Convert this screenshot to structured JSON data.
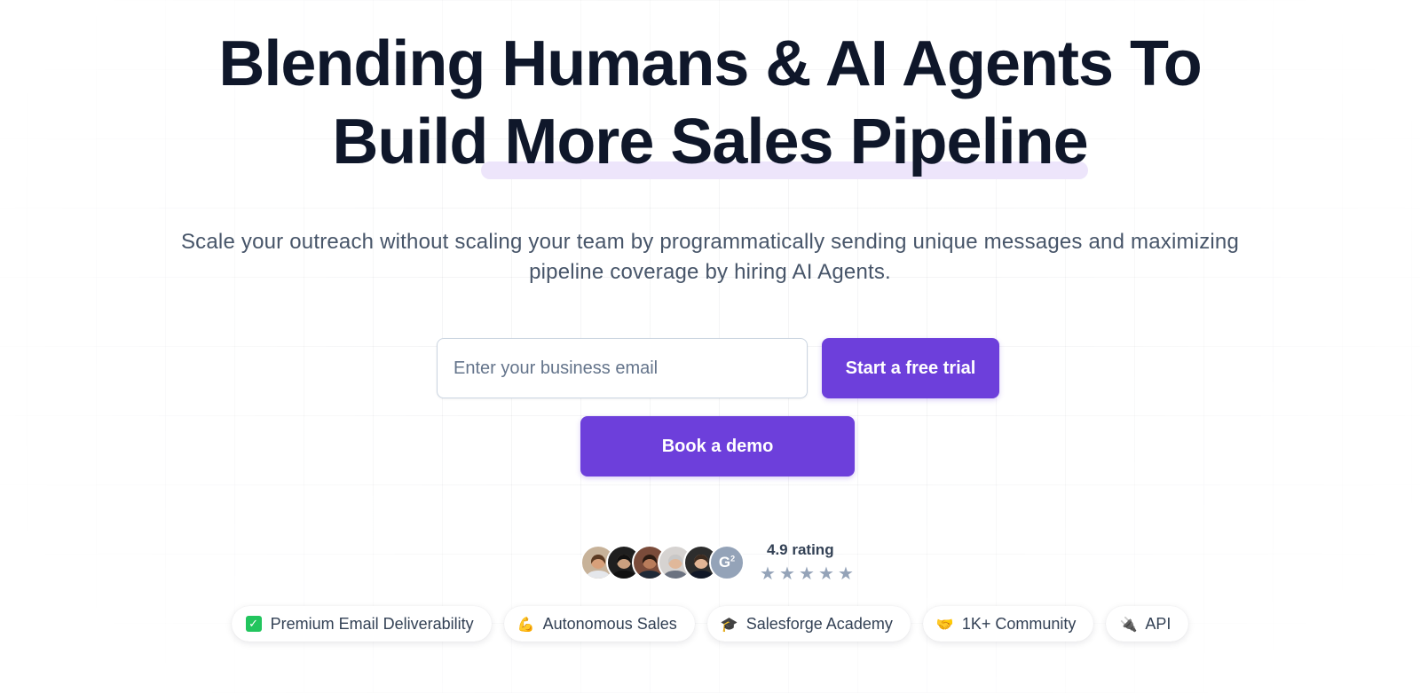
{
  "hero": {
    "title_line1": "Blending Humans & AI Agents To",
    "title_line2_before": "Build ",
    "title_line2_highlight": "More Sales Pipeline",
    "subtitle": "Scale your outreach without scaling your team by programmatically sending unique messages and maximizing pipeline coverage by hiring AI Agents."
  },
  "signup": {
    "email_placeholder": "Enter your business email",
    "email_value": "",
    "trial_label": "Start a free trial",
    "demo_label": "Book a demo"
  },
  "social_proof": {
    "rating_label": "4.9 rating",
    "rating_value": 4.9,
    "stars": 5,
    "star_glyph": "★",
    "badge_text": "G",
    "badge_sup": "2",
    "avatars": [
      {
        "name": "avatar-1",
        "skin": "#d8a07a",
        "hair": "#5b3a22",
        "shirt": "#e5e7eb",
        "bg": "#c7b299"
      },
      {
        "name": "avatar-2",
        "skin": "#caa07f",
        "hair": "#111111",
        "shirt": "#111111",
        "bg": "#1f1f1f"
      },
      {
        "name": "avatar-3",
        "skin": "#b97c5b",
        "hair": "#2b1a12",
        "shirt": "#1f2937",
        "bg": "#7a4b3a"
      },
      {
        "name": "avatar-4",
        "skin": "#e0b89a",
        "hair": "#c8c8c8",
        "shirt": "#6b7280",
        "bg": "#d6d3d1"
      },
      {
        "name": "avatar-5",
        "skin": "#e2b595",
        "hair": "#3b2a1f",
        "shirt": "#111827",
        "bg": "#2d2d2d"
      }
    ]
  },
  "features": [
    {
      "icon": "check-mark-icon",
      "glyph": "✓",
      "label": "Premium Email Deliverability"
    },
    {
      "icon": "flexed-biceps-icon",
      "glyph": "💪",
      "label": "Autonomous Sales"
    },
    {
      "icon": "graduation-cap-icon",
      "glyph": "🎓",
      "label": "Salesforge Academy"
    },
    {
      "icon": "handshake-icon",
      "glyph": "🤝",
      "label": "1K+ Community"
    },
    {
      "icon": "plug-icon",
      "glyph": "🔌",
      "label": "API"
    }
  ],
  "colors": {
    "primary": "#6d3fdb",
    "heading": "#0f172a",
    "body_text": "#475569",
    "highlight": "#ede5fb",
    "star": "#94a3b8"
  }
}
